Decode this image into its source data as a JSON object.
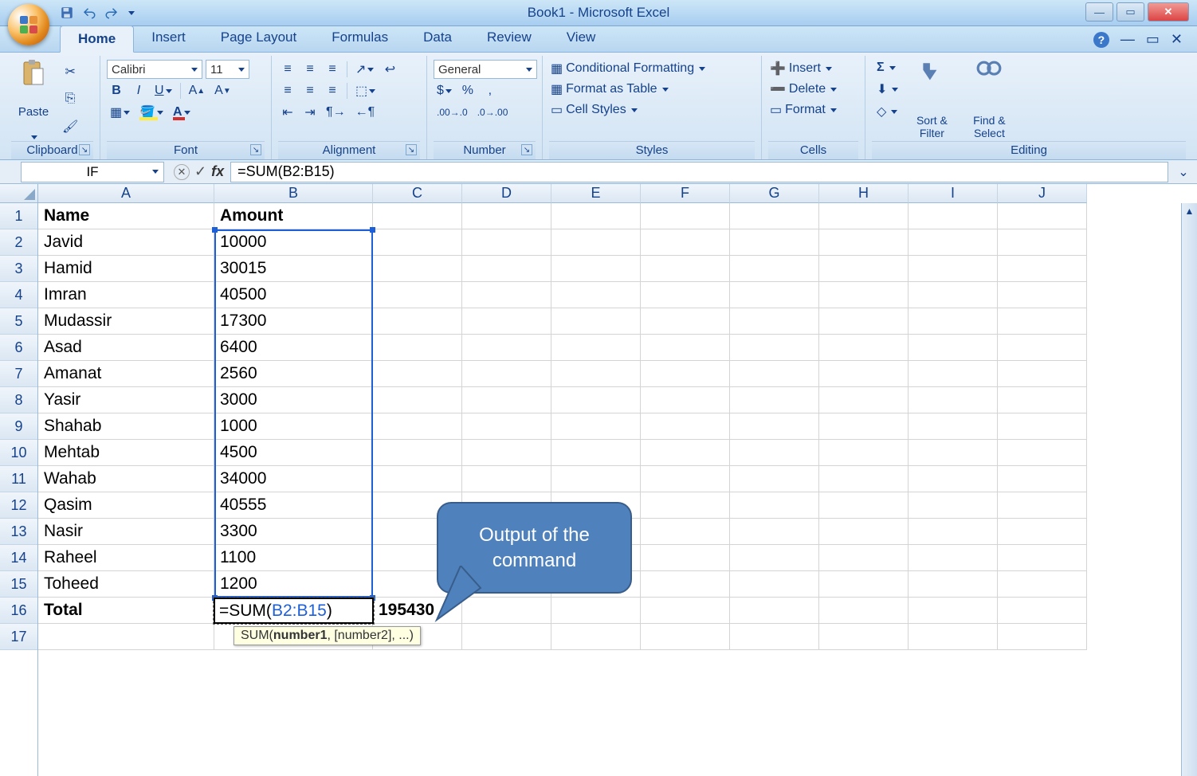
{
  "app_title": "Book1 - Microsoft Excel",
  "tabs": [
    "Home",
    "Insert",
    "Page Layout",
    "Formulas",
    "Data",
    "Review",
    "View"
  ],
  "active_tab": "Home",
  "ribbon": {
    "clipboard": {
      "label": "Clipboard",
      "paste": "Paste"
    },
    "font": {
      "label": "Font",
      "name": "Calibri",
      "size": "11"
    },
    "alignment": {
      "label": "Alignment"
    },
    "number": {
      "label": "Number",
      "format": "General"
    },
    "styles": {
      "label": "Styles",
      "conditional": "Conditional Formatting",
      "table": "Format as Table",
      "cellstyles": "Cell Styles"
    },
    "cells": {
      "label": "Cells",
      "insert": "Insert",
      "delete": "Delete",
      "format": "Format"
    },
    "editing": {
      "label": "Editing",
      "sort": "Sort & Filter",
      "find": "Find & Select"
    }
  },
  "namebox": "IF",
  "formula_bar": "=SUM(B2:B15)",
  "columns": [
    "A",
    "B",
    "C",
    "D",
    "E",
    "F",
    "G",
    "H",
    "I",
    "J"
  ],
  "rows": [
    1,
    2,
    3,
    4,
    5,
    6,
    7,
    8,
    9,
    10,
    11,
    12,
    13,
    14,
    15,
    16,
    17
  ],
  "headers": {
    "A": "Name",
    "B": "Amount"
  },
  "data": [
    {
      "name": "Javid",
      "amount": "10000"
    },
    {
      "name": "Hamid",
      "amount": "30015"
    },
    {
      "name": "Imran",
      "amount": "40500"
    },
    {
      "name": "Mudassir",
      "amount": "17300"
    },
    {
      "name": "Asad",
      "amount": "6400"
    },
    {
      "name": "Amanat",
      "amount": "2560"
    },
    {
      "name": "Yasir",
      "amount": "3000"
    },
    {
      "name": "Shahab",
      "amount": "1000"
    },
    {
      "name": "Mehtab",
      "amount": "4500"
    },
    {
      "name": "Wahab",
      "amount": "34000"
    },
    {
      "name": "Qasim",
      "amount": "40555"
    },
    {
      "name": "Nasir",
      "amount": "3300"
    },
    {
      "name": "Raheel",
      "amount": "1100"
    },
    {
      "name": "Toheed",
      "amount": "1200"
    }
  ],
  "total_label": "Total",
  "active_formula_prefix": "=SUM(",
  "active_formula_ref": "B2:B15",
  "active_formula_suffix": ")",
  "result_c16": "195430",
  "fn_tooltip_name": "SUM(",
  "fn_tooltip_bold": "number1",
  "fn_tooltip_rest": ", [number2], ...)",
  "callout_text": "Output of the command"
}
